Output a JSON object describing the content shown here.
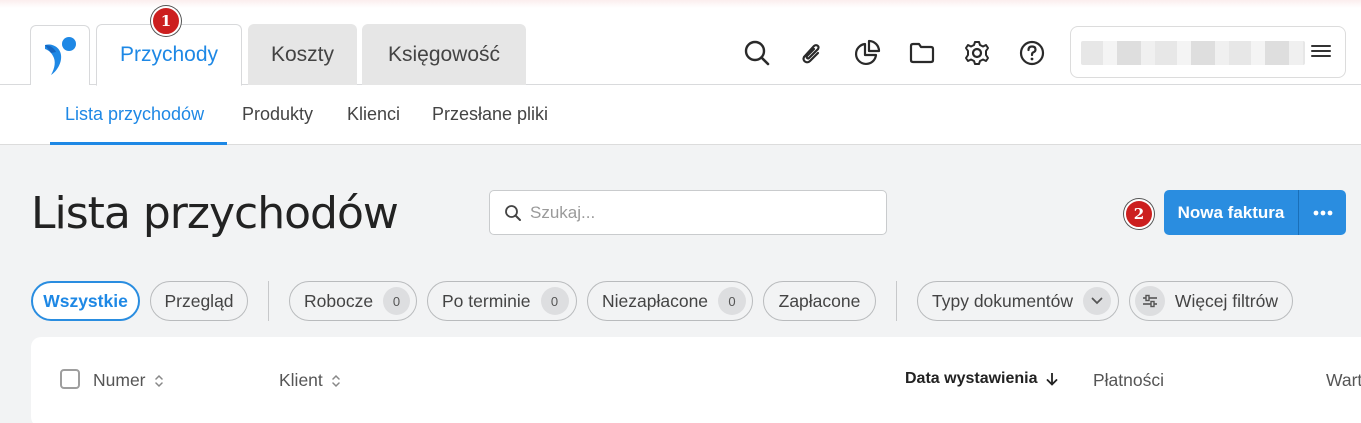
{
  "header": {
    "tabs": [
      {
        "label": "Przychody",
        "active": true
      },
      {
        "label": "Koszty",
        "active": false
      },
      {
        "label": "Księgowość",
        "active": false
      }
    ],
    "icons": [
      "search-icon",
      "paperclip-icon",
      "pie-chart-icon",
      "folder-icon",
      "gear-icon",
      "help-icon"
    ],
    "menu_icon": "hamburger-menu-icon",
    "accent": "#1e88e5"
  },
  "markers": {
    "first": "1",
    "second": "2"
  },
  "subnav": {
    "items": [
      {
        "label": "Lista przychodów",
        "active": true
      },
      {
        "label": "Produkty",
        "active": false
      },
      {
        "label": "Klienci",
        "active": false
      },
      {
        "label": "Przesłane pliki",
        "active": false
      }
    ]
  },
  "page": {
    "title": "Lista przychodów",
    "search_placeholder": "Szukaj...",
    "new_invoice_label": "Nowa faktura",
    "primary_color": "#2a8de0"
  },
  "filters": {
    "all": "Wszystkie",
    "review": "Przegląd",
    "drafts": {
      "label": "Robocze",
      "count": "0"
    },
    "overdue": {
      "label": "Po terminie",
      "count": "0"
    },
    "unpaid": {
      "label": "Niezapłacone",
      "count": "0"
    },
    "paid": "Zapłacone",
    "doc_types": "Typy dokumentów",
    "more_filters": "Więcej filtrów"
  },
  "table": {
    "columns": {
      "number": "Numer",
      "client": "Klient",
      "issue_date": "Data wystawienia",
      "payments": "Płatności",
      "value": "Wart"
    }
  }
}
